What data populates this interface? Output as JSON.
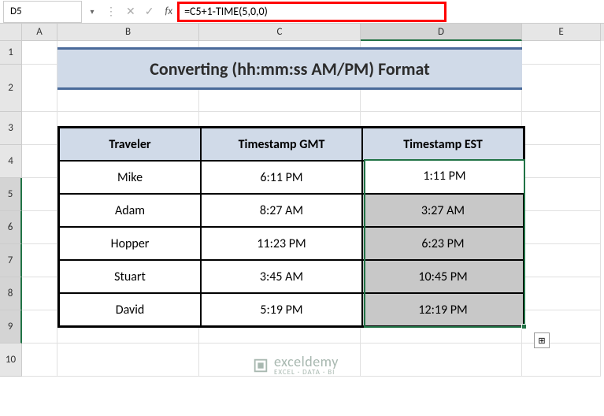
{
  "nameBox": {
    "cellRef": "D5"
  },
  "formulaBar": {
    "formula": "=C5+1-TIME(5,0,0)"
  },
  "columns": {
    "a": "A",
    "b": "B",
    "c": "C",
    "d": "D",
    "e": "E"
  },
  "rowLabels": {
    "r1": "1",
    "r2": "2",
    "r3": "3",
    "r4": "4",
    "r5": "5",
    "r6": "6",
    "r7": "7",
    "r8": "8",
    "r9": "9",
    "r10": "10"
  },
  "title": "Converting (hh:mm:ss AM/PM) Format",
  "table": {
    "headers": {
      "traveler": "Traveler",
      "gmt": "Timestamp GMT",
      "est": "Timestamp EST"
    },
    "rows": [
      {
        "traveler": "Mike",
        "gmt": "6:11 PM",
        "est": "1:11 PM"
      },
      {
        "traveler": "Adam",
        "gmt": "8:27 AM",
        "est": "3:27 AM"
      },
      {
        "traveler": "Hopper",
        "gmt": "11:23 PM",
        "est": "6:23 PM"
      },
      {
        "traveler": "Stuart",
        "gmt": "3:45 AM",
        "est": "10:45 PM"
      },
      {
        "traveler": "David",
        "gmt": "5:19 PM",
        "est": "12:19 PM"
      }
    ]
  },
  "watermark": {
    "brand": "exceldemy",
    "tagline": "EXCEL · DATA · BI"
  },
  "icons": {
    "dropdown": "▾",
    "cancel": "✕",
    "enter": "✓",
    "ellipsis": "⋮",
    "fx": "fx",
    "autofill": "⊞"
  }
}
